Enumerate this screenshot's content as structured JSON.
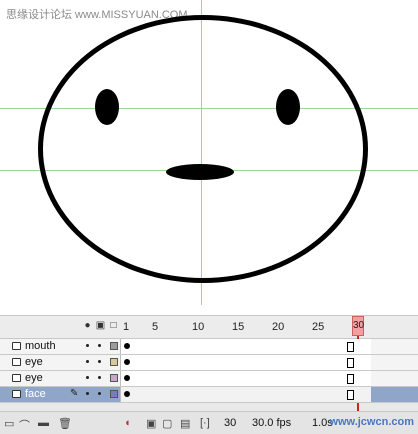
{
  "watermark": {
    "top_left": "思缘设计论坛 www.MISSYUAN.COM",
    "bottom_right": "www.jcwcn.com"
  },
  "stage": {
    "shapes": {
      "face": "face outline",
      "left_eye": "eye",
      "right_eye": "eye",
      "mouth": "mouth"
    }
  },
  "timeline": {
    "header_icons": [
      "eye-icon",
      "lock-icon",
      "outline-icon"
    ],
    "frame_numbers": [
      "1",
      "5",
      "10",
      "15",
      "20",
      "25",
      "30"
    ],
    "playhead_frame": "30",
    "layers": [
      {
        "name": "mouth",
        "selected": false,
        "swatch": "#9b9b9b"
      },
      {
        "name": "eye",
        "selected": false,
        "swatch": "#d9c89a"
      },
      {
        "name": "eye",
        "selected": false,
        "swatch": "#c8a8c8"
      },
      {
        "name": "face",
        "selected": true,
        "swatch": "#7a7ac0"
      }
    ],
    "footer": {
      "current_frame": "30",
      "frame_rate": "30.0 fps",
      "elapsed": "1.0s"
    }
  }
}
